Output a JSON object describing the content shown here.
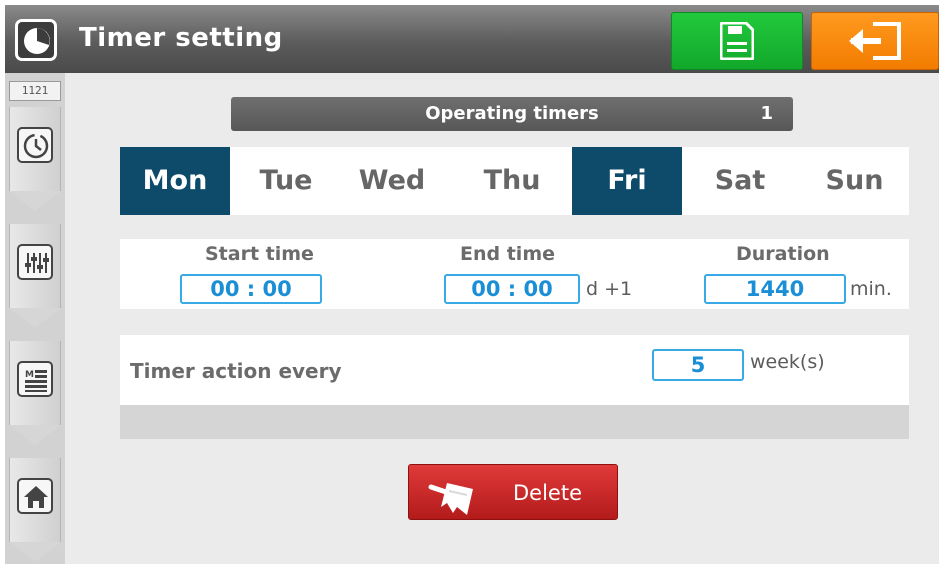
{
  "header": {
    "title": "Timer setting",
    "app_icon": "pie-clock-icon",
    "save_icon": "floppy-disk-icon",
    "exit_icon": "exit-arrow-icon",
    "colors": {
      "save": "#1db534",
      "exit": "#f5870a"
    }
  },
  "sidebar": {
    "screen_code": "1121",
    "tabs": [
      {
        "icon": "clock-timer-icon"
      },
      {
        "icon": "sliders-icon"
      },
      {
        "icon": "menu-list-icon"
      },
      {
        "icon": "home-icon"
      }
    ]
  },
  "operating": {
    "title": "Operating timers",
    "number": "1"
  },
  "days": [
    {
      "label": "Mon",
      "active": true
    },
    {
      "label": "Tue",
      "active": false
    },
    {
      "label": "Wed",
      "active": false
    },
    {
      "label": "Thu",
      "active": false
    },
    {
      "label": "Fri",
      "active": true
    },
    {
      "label": "Sat",
      "active": false
    },
    {
      "label": "Sun",
      "active": false
    }
  ],
  "times": {
    "start_label": "Start time",
    "start_value": "00 : 00",
    "end_label": "End time",
    "end_value": "00 : 00",
    "end_suffix": "d +1",
    "duration_label": "Duration",
    "duration_value": "1440",
    "duration_unit": "min."
  },
  "action": {
    "label": "Timer action every",
    "value": "5",
    "unit": "week(s)"
  },
  "delete": {
    "label": "Delete",
    "icon": "broom-icon"
  },
  "colors": {
    "active_day": "#0e4b6b",
    "field_border": "#37a9e4",
    "field_text": "#1b8fd6",
    "delete": "#c62828"
  }
}
